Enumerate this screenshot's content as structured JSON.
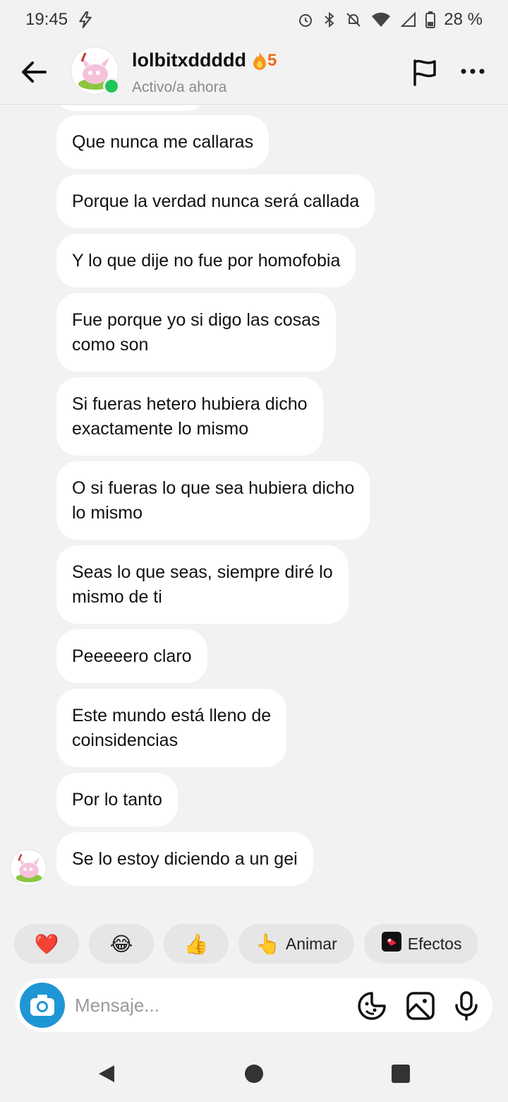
{
  "status_bar": {
    "time": "19:45",
    "battery": "28 %",
    "icons": [
      "flash-icon",
      "alarm-icon",
      "bluetooth-icon",
      "notifications-off-icon",
      "wifi-icon",
      "signal-icon",
      "battery-icon"
    ]
  },
  "header": {
    "username": "lolbitxddddd",
    "streak_count": "5",
    "status": "Activo/a ahora",
    "online_color": "#21c45a",
    "streak_color": "#f26a1b"
  },
  "messages": [
    {
      "text": "Que nunca me callaras"
    },
    {
      "text": "Porque la verdad nunca será callada"
    },
    {
      "text": "Y lo que dije no fue por homofobia"
    },
    {
      "text": "Fue porque yo si digo las cosas\ncomo son"
    },
    {
      "text": "Si fueras hetero hubiera dicho\nexactamente lo mismo"
    },
    {
      "text": "O si fueras lo que sea hubiera dicho\nlo mismo"
    },
    {
      "text": "Seas lo que seas, siempre diré lo\nmismo de ti"
    },
    {
      "text": "Peeeeero claro"
    },
    {
      "text": "Este mundo está lleno de\ncoinsidencias"
    },
    {
      "text": "Por lo tanto"
    },
    {
      "text": "Se lo estoy diciendo a un gei"
    }
  ],
  "reactions": [
    {
      "emoji": "❤️",
      "icon": "heart-icon"
    },
    {
      "emoji": "😂",
      "icon": "laughing-icon"
    },
    {
      "emoji": "👍",
      "icon": "thumbs-up-icon"
    },
    {
      "emoji": "👆",
      "label": "Animar",
      "icon": "pointing-hand-icon"
    },
    {
      "label": "Efectos",
      "icon": "effects-icon"
    }
  ],
  "composer": {
    "placeholder": "Mensaje...",
    "accent": "#1f96d4"
  }
}
